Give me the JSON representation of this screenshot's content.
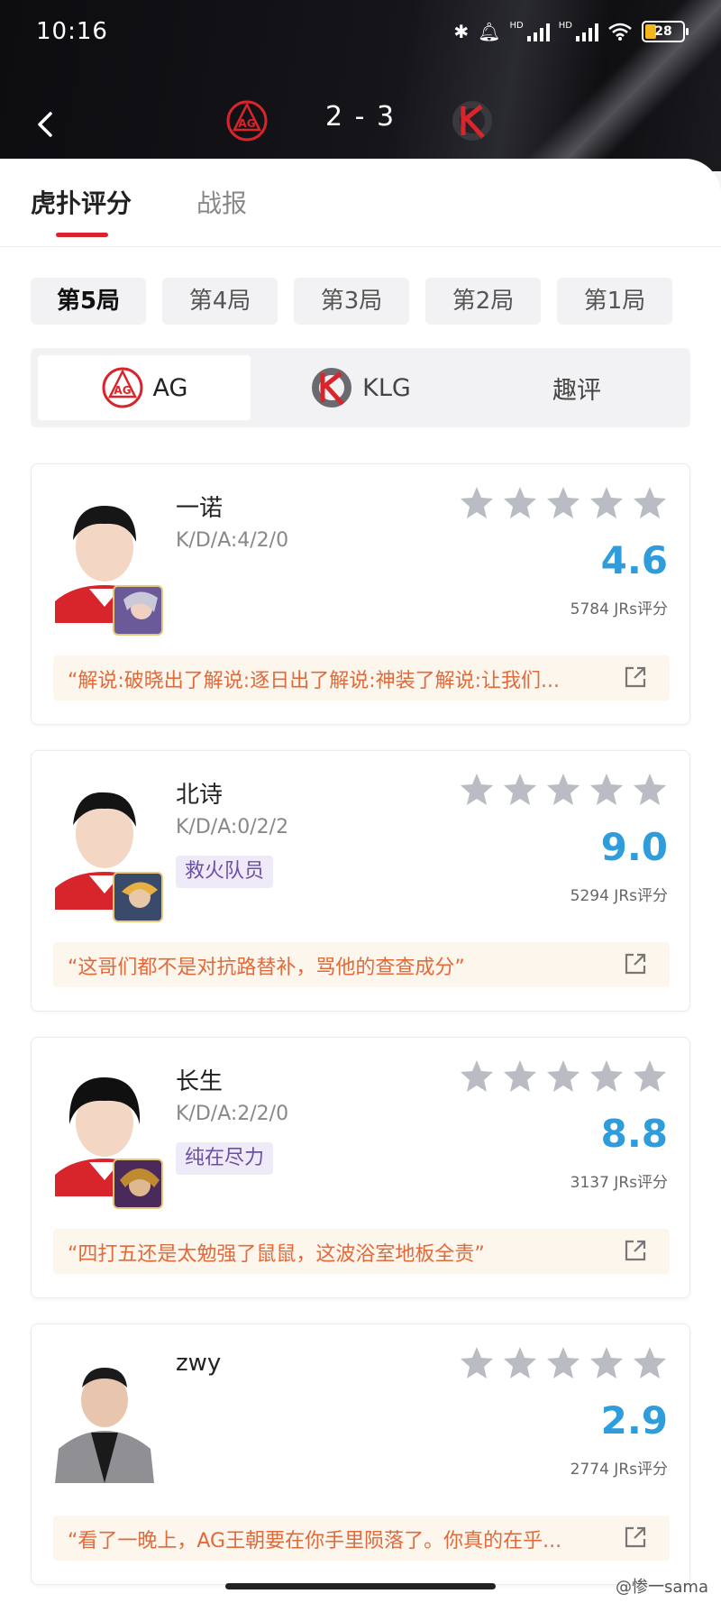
{
  "status_bar": {
    "time": "10:16",
    "battery": "28"
  },
  "header": {
    "score": "2 - 3",
    "back_icon": "chevron-left-icon"
  },
  "tabs": [
    {
      "label": "虎扑评分",
      "active": true
    },
    {
      "label": "战报",
      "active": false
    }
  ],
  "rounds": [
    "第5局",
    "第4局",
    "第3局",
    "第2局",
    "第1局"
  ],
  "team_switch": {
    "team_a": "AG",
    "team_b": "KLG",
    "fun": "趣评"
  },
  "players": [
    {
      "name": "一诺",
      "kda": "K/D/A:4/2/0",
      "tag": "",
      "rating": "4.6",
      "votes": "5784 JRs评分",
      "comment": "“解说:破晓出了解说:逐日出了解说:神装了解说:让我们..."
    },
    {
      "name": "北诗",
      "kda": "K/D/A:0/2/2",
      "tag": "救火队员",
      "rating": "9.0",
      "votes": "5294 JRs评分",
      "comment": "“这哥们都不是对抗路替补，骂他的查查成分”"
    },
    {
      "name": "长生",
      "kda": "K/D/A:2/2/0",
      "tag": "纯在尽力",
      "rating": "8.8",
      "votes": "3137 JRs评分",
      "comment": "“四打五还是太勉强了鼠鼠，这波浴室地板全责”"
    },
    {
      "name": "zwy",
      "kda": "",
      "tag": "",
      "rating": "2.9",
      "votes": "2774 JRs评分",
      "comment": "“看了一晚上，AG王朝要在你手里陨落了。你真的在乎..."
    }
  ],
  "colors": {
    "accent": "#d8252b",
    "rating": "#2f9ddb",
    "comment": "#e06a3a"
  },
  "watermark": "@惨一sama"
}
